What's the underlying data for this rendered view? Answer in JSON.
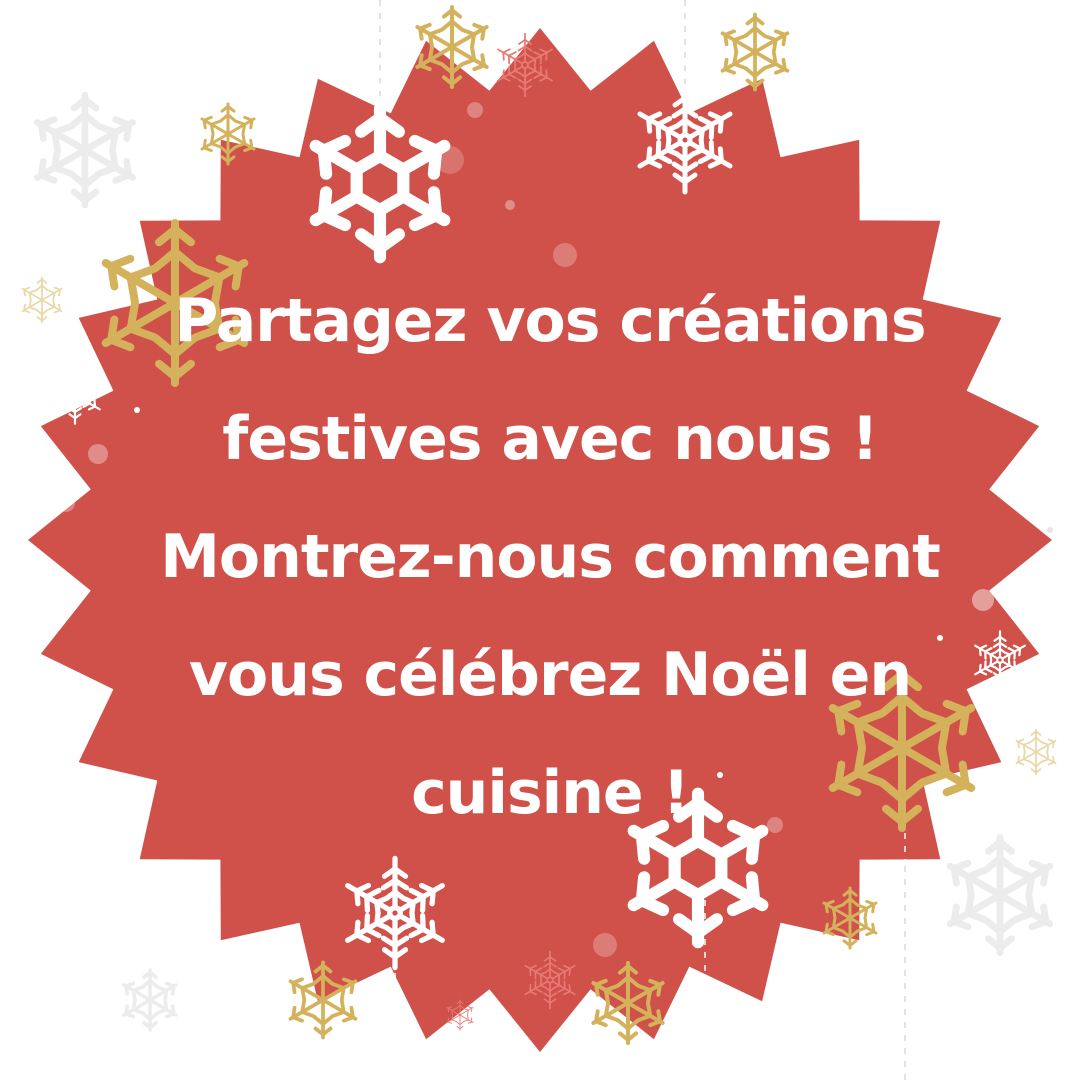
{
  "card": {
    "message_lines": [
      "Partagez vos créations",
      "festives avec nous !",
      "Montrez-nous comment",
      "vous célébrez Noël en",
      "cuisine !"
    ]
  },
  "colors": {
    "background": "#ffffff",
    "badge": "#d0504a",
    "text": "#ffffff",
    "gold": "#d4b25c",
    "white_flake": "#ffffff",
    "pale_flake": "#ececec",
    "pink_flake": "#e87a76"
  },
  "decorations": {
    "icon": "snowflake-icon",
    "badge_shape": "scalloped-starburst"
  }
}
